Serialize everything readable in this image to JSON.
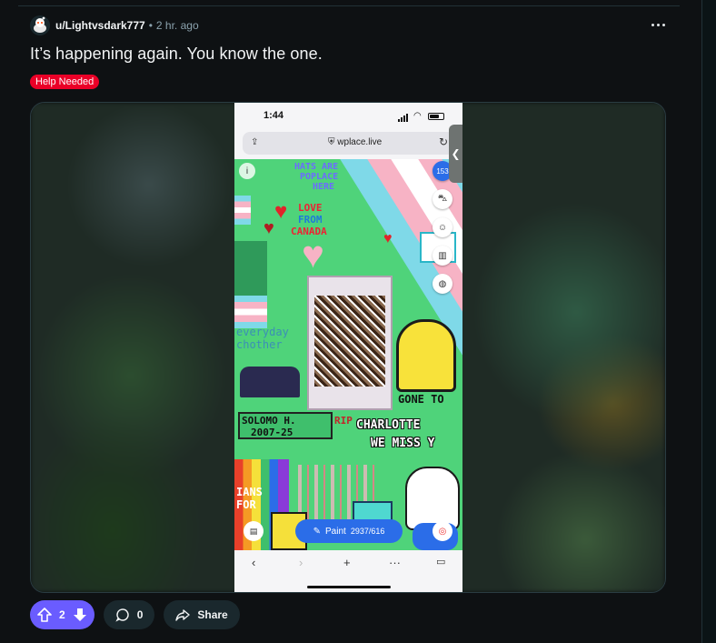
{
  "post": {
    "author": "u/Lightvsdark777",
    "separator": "•",
    "time_ago": "2 hr. ago",
    "title": "It’s happening again. You know the one.",
    "flair": "Help Needed",
    "flair_color": "#ea0027"
  },
  "phone": {
    "clock": "1:44",
    "url": "wplace.live",
    "canvas_texts": {
      "hats": "HATS ARE",
      "hats2": "POPLACE",
      "hats3": "HERE",
      "love": "LOVE",
      "from": "FROM",
      "canada": "CANADA",
      "everyday": "everyday",
      "chother": "chother",
      "gone": "GONE TO",
      "solomo": "SOLOMO  H.",
      "years": "2007-25",
      "rip": "RIP",
      "charlotte": "CHARLOTTE",
      "miss": "WE MISS Y",
      "ians": "IANS",
      "for": "FOR",
      "user_count": "153"
    },
    "paint_label": "Paint",
    "paint_count": "2937/616"
  },
  "actions": {
    "vote_count": "2",
    "comment_count": "0",
    "share_label": "Share"
  },
  "colors": {
    "background": "#0e1113",
    "upvote_accent": "#6a5cff",
    "pill_bg": "#1a282d",
    "paint_button": "#2b6de8"
  }
}
